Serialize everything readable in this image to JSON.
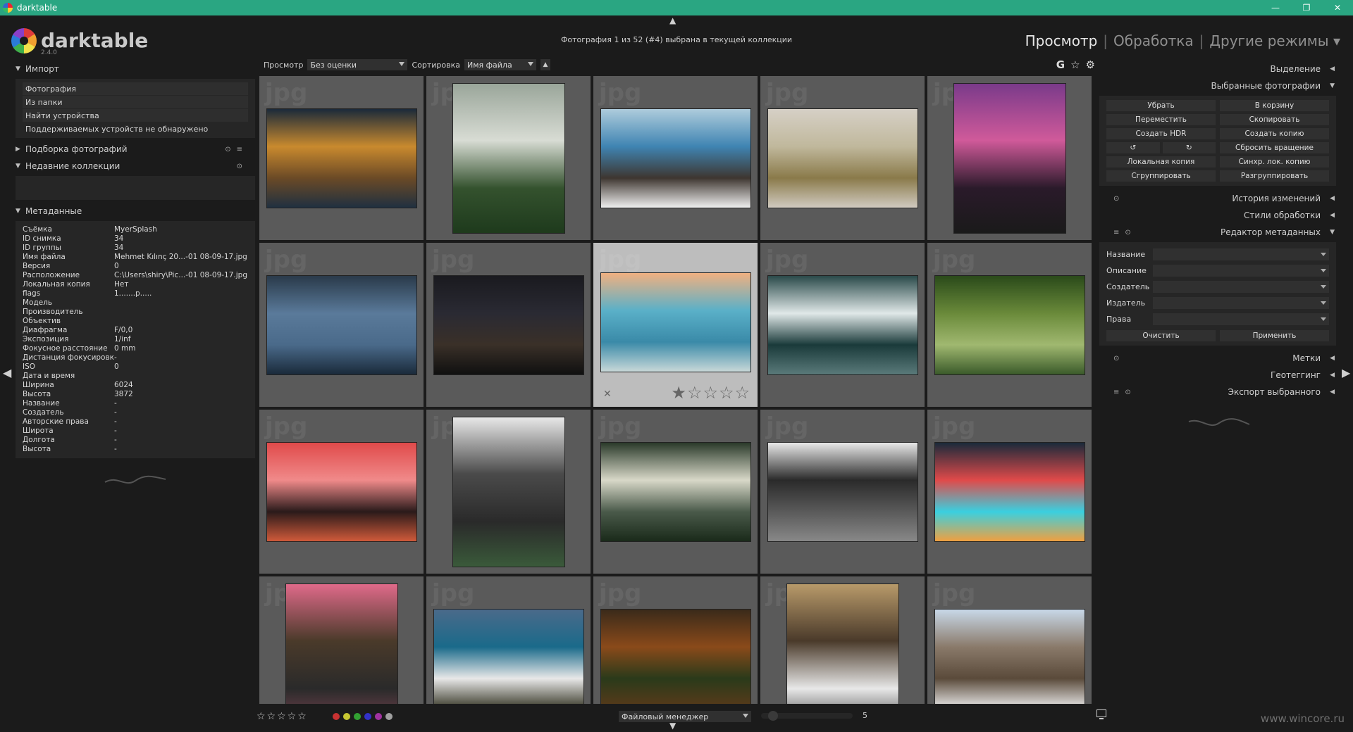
{
  "window": {
    "title": "darktable",
    "controls": {
      "minimize": "—",
      "restore": "❐",
      "close": "✕"
    }
  },
  "header": {
    "logo_name": "darktable",
    "version": "2.4.0",
    "status": "Фотография 1 из 52 (#4) выбрана в текущей коллекции",
    "views": {
      "active": "Просмотр",
      "edit": "Обработка",
      "other": "Другие режимы",
      "separator": "|"
    }
  },
  "left": {
    "import": {
      "title": "Импорт",
      "items": [
        "Фотография",
        "Из папки",
        "Найти устройства",
        "Поддерживаемых устройств не обнаружено"
      ]
    },
    "collect": {
      "title": "Подборка фотографий"
    },
    "recent": {
      "title": "Недавние коллекции"
    },
    "metadata": {
      "title": "Метаданные",
      "rows": [
        {
          "k": "Съёмка",
          "v": "MyerSplash"
        },
        {
          "k": "ID снимка",
          "v": "34"
        },
        {
          "k": "ID группы",
          "v": "34"
        },
        {
          "k": "Имя файла",
          "v": "Mehmet Kılınç 20...-01 08-09-17.jpg"
        },
        {
          "k": "Версия",
          "v": "0"
        },
        {
          "k": "Расположение",
          "v": "C:\\Users\\shiry\\Pic...-01 08-09-17.jpg"
        },
        {
          "k": "Локальная копия",
          "v": "Нет"
        },
        {
          "k": "flags",
          "v": "1.......p....."
        },
        {
          "k": "Модель",
          "v": ""
        },
        {
          "k": "Производитель",
          "v": ""
        },
        {
          "k": "Объектив",
          "v": ""
        },
        {
          "k": "Диафрагма",
          "v": "F/0,0"
        },
        {
          "k": "Экспозиция",
          "v": "1/inf"
        },
        {
          "k": "Фокусное расстояние",
          "v": "0 mm"
        },
        {
          "k": "Дистанция фокусировки",
          "v": "-"
        },
        {
          "k": "ISO",
          "v": "0"
        },
        {
          "k": "Дата и время",
          "v": ""
        },
        {
          "k": "Ширина",
          "v": "6024"
        },
        {
          "k": "Высота",
          "v": "3872"
        },
        {
          "k": "Название",
          "v": "-"
        },
        {
          "k": "Создатель",
          "v": "-"
        },
        {
          "k": "Авторские права",
          "v": "-"
        },
        {
          "k": "Широта",
          "v": "-"
        },
        {
          "k": "Долгота",
          "v": "-"
        },
        {
          "k": "Высота",
          "v": "-"
        }
      ]
    }
  },
  "toolbar": {
    "view_label": "Просмотр",
    "view_value": "Без оценки",
    "sort_label": "Сортировка",
    "sort_value": "Имя файла",
    "sort_dir": "▲",
    "icons": {
      "grouping": "G",
      "overlays": "☆",
      "settings": "⚙"
    }
  },
  "grid": {
    "watermark": "jpg",
    "active_stars": "☆☆☆☆☆",
    "active_first_star": "★",
    "active_reject": "✕",
    "thumbs": [
      {
        "colors": [
          "#1b2a3a",
          "#c98a2e",
          "#6b4a26",
          "#203040"
        ],
        "shape": "land"
      },
      {
        "colors": [
          "#9aa69a",
          "#d8dcd4",
          "#34522e",
          "#1e3a1c"
        ],
        "shape": "tall"
      },
      {
        "colors": [
          "#aeccdc",
          "#3f84b2",
          "#3e3630",
          "#efefef"
        ],
        "shape": "land"
      },
      {
        "colors": [
          "#d6d0c6",
          "#c0b89c",
          "#8a7a4a",
          "#d0cac0"
        ],
        "shape": "land"
      },
      {
        "colors": [
          "#7a3a8a",
          "#d05a9a",
          "#2a1a2a",
          "#1a1a1a"
        ],
        "shape": "tall"
      },
      {
        "colors": [
          "#2a3a4a",
          "#5a7a9a",
          "#4a6a8a",
          "#1a2a3a"
        ],
        "shape": "land"
      },
      {
        "colors": [
          "#1a1a1f",
          "#2a2a33",
          "#3a3028",
          "#101010"
        ],
        "shape": "land"
      },
      {
        "colors": [
          "#f0b080",
          "#5ab0c8",
          "#3a8aa8",
          "#c8d8d8"
        ],
        "shape": "land"
      },
      {
        "colors": [
          "#2a4a4a",
          "#e0e8e8",
          "#1a3a3a",
          "#5a7a7a"
        ],
        "shape": "land"
      },
      {
        "colors": [
          "#2a4a1a",
          "#6a8a3a",
          "#a0b870",
          "#3a5a2a"
        ],
        "shape": "land"
      },
      {
        "colors": [
          "#e04a4a",
          "#f08a8a",
          "#2a1a1a",
          "#d05a3a"
        ],
        "shape": "land"
      },
      {
        "colors": [
          "#e8e8e8",
          "#4a4a4a",
          "#2a2a2a",
          "#3a5a3a"
        ],
        "shape": "tall"
      },
      {
        "colors": [
          "#2a3a2a",
          "#d8d8c8",
          "#4a5a4a",
          "#1a2a1a"
        ],
        "shape": "land"
      },
      {
        "colors": [
          "#e8e8e8",
          "#2a2a2a",
          "#5a5a5a",
          "#888888"
        ],
        "shape": "land"
      },
      {
        "colors": [
          "#1a2a3a",
          "#e04a4a",
          "#3ad0e0",
          "#f0a040"
        ],
        "shape": "land"
      },
      {
        "colors": [
          "#e06a8a",
          "#4a3a2a",
          "#2a2a2a",
          "#8a4a5a"
        ],
        "shape": "tall"
      },
      {
        "colors": [
          "#4a6a8a",
          "#1a6a8a",
          "#e8e8e8",
          "#3a3a2a"
        ],
        "shape": "land"
      },
      {
        "colors": [
          "#3a2a1a",
          "#8a4a1a",
          "#2a3a1a",
          "#5a3a1a"
        ],
        "shape": "land"
      },
      {
        "colors": [
          "#b89a6a",
          "#4a3a2a",
          "#e8e8e8",
          "#2a2a2a"
        ],
        "shape": "tall"
      },
      {
        "colors": [
          "#c8d8e8",
          "#8a7a6a",
          "#5a4a3a",
          "#e8e8e8"
        ],
        "shape": "land"
      }
    ]
  },
  "bottom": {
    "stars": "☆☆☆☆☆",
    "colors": [
      "#c83232",
      "#c8c832",
      "#32a032",
      "#3232c8",
      "#a032a0",
      "#a0a0a0"
    ],
    "layout_value": "Файловый менеджер",
    "zoom_value": "5",
    "watermark": "www.wincore.ru"
  },
  "right": {
    "select": {
      "title": "Выделение"
    },
    "selected": {
      "title": "Выбранные фотографии",
      "buttons": [
        "Убрать",
        "В корзину",
        "Переместить",
        "Скопировать",
        "Создать HDR",
        "Создать копию",
        "↺",
        "↻",
        "Сбросить вращение",
        "Локальная копия",
        "Синхр. лок. копию",
        "Сгруппировать",
        "Разгруппировать"
      ]
    },
    "history": {
      "title": "История изменений"
    },
    "styles": {
      "title": "Стили обработки"
    },
    "metadata_editor": {
      "title": "Редактор метаданных",
      "fields": [
        "Название",
        "Описание",
        "Создатель",
        "Издатель",
        "Права"
      ],
      "clear": "Очистить",
      "apply": "Применить"
    },
    "tags": {
      "title": "Метки"
    },
    "geotag": {
      "title": "Геотеггинг"
    },
    "export": {
      "title": "Экспорт выбранного"
    }
  }
}
